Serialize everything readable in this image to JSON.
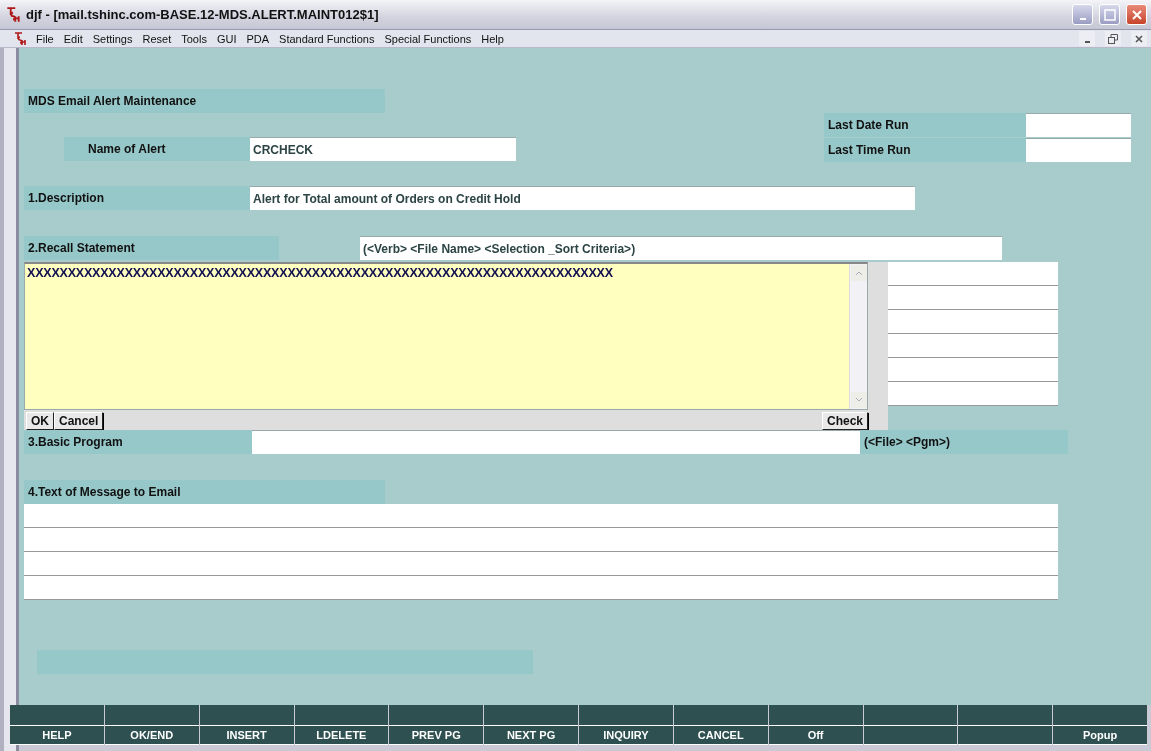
{
  "window": {
    "title": "djf - [mail.tshinc.com-BASE.12-MDS.ALERT.MAINT012$1]"
  },
  "menu": [
    "File",
    "Edit",
    "Settings",
    "Reset",
    "Tools",
    "GUI",
    "PDA",
    "Standard Functions",
    "Special Functions",
    "Help"
  ],
  "form": {
    "heading": "MDS Email Alert Maintenance",
    "name_of_alert": {
      "label": "Name of Alert",
      "value": "CRCHECK"
    },
    "last_date_run": {
      "label": "Last Date Run"
    },
    "last_time_run": {
      "label": "Last Time Run"
    },
    "description": {
      "label": "1.Description",
      "value": "Alert for Total amount of Orders on Credit Hold"
    },
    "recall_statement": {
      "label": "2.Recall Statement",
      "hint": "(<Verb> <File Name> <Selection _Sort Criteria>)"
    },
    "editor": {
      "value": "XXXXXXXXXXXXXXXXXXXXXXXXXXXXXXXXXXXXXXXXXXXXXXXXXXXXXXXXXXXXXXXXXXXXXXXX",
      "buttons": [
        "OK",
        "Cancel"
      ],
      "check_button": "Check"
    },
    "basic_program": {
      "label": "3.Basic Program",
      "hint": "(<File> <Pgm>)"
    },
    "message": {
      "label": "4.Text of Message to Email"
    }
  },
  "function_keys": [
    {
      "label": "HELP"
    },
    {
      "label": "OK/END"
    },
    {
      "label": "INSERT"
    },
    {
      "label": "LDELETE"
    },
    {
      "label": "PREV PG"
    },
    {
      "label": "NEXT PG"
    },
    {
      "label": "INQUIRY"
    },
    {
      "label": "CANCEL"
    },
    {
      "label": "Off"
    },
    {
      "kind": "blank"
    },
    {
      "kind": "blank"
    },
    {
      "label": "Popup"
    }
  ]
}
